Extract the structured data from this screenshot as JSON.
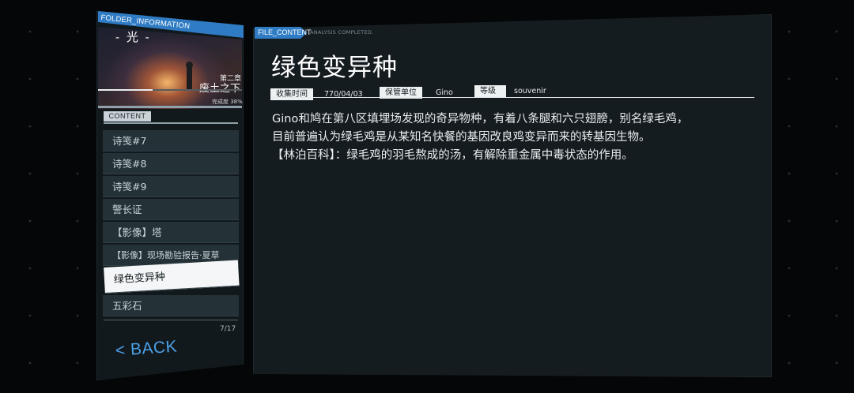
{
  "left_panel": {
    "header_label": "FOLDER_INFORMATION",
    "cover": {
      "title": "- 光 -",
      "chapter_label": "第二章",
      "chapter_title": "废土之下",
      "progress_text": "完成度 38%",
      "progress_fraction": 0.38
    },
    "content_tab": "CONTENT",
    "items": [
      {
        "label": "诗笺#7"
      },
      {
        "label": "诗笺#8"
      },
      {
        "label": "诗笺#9"
      },
      {
        "label": "警长证"
      },
      {
        "label": "【影像】塔"
      },
      {
        "label": "【影像】现场勘验报告·夏草"
      },
      {
        "label": "绿色变异种"
      },
      {
        "label": "五彩石"
      }
    ],
    "active_index": 6,
    "count": "7/17",
    "back_label": "< BACK"
  },
  "main": {
    "tab_label": "FILE_CONTENT",
    "status": "ANALYSIS COMPLETED.",
    "title": "绿色变异种",
    "meta": {
      "collect_time_label": "收集时间",
      "collect_time_value": "770/04/03",
      "custody_label": "保管单位",
      "custody_value": "Gino",
      "grade_label": "等级",
      "grade_value": "souvenir"
    },
    "description": [
      "Gino和鸠在第八区填埋场发现的奇异物种，有着八条腿和六只翅膀，别名绿毛鸡，",
      "目前普遍认为绿毛鸡是从某知名快餐的基因改良鸡变异而来的转基因生物。",
      "【林泊百科】：绿毛鸡的羽毛熬成的汤，有解除重金属中毒状态的作用。"
    ]
  },
  "colors": {
    "accent_blue": "#2f7cc4",
    "back_blue": "#4aa0e6",
    "panel_bg": "#151c20",
    "active_item_bg": "#f4f6f7"
  }
}
